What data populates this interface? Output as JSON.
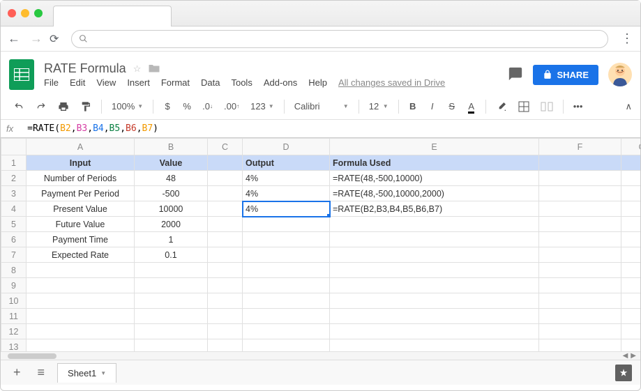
{
  "browser": {},
  "sheets": {
    "title": "RATE Formula",
    "menus": [
      "File",
      "Edit",
      "View",
      "Insert",
      "Format",
      "Data",
      "Tools",
      "Add-ons",
      "Help"
    ],
    "changes_saved": "All changes saved in Drive",
    "share_label": "SHARE"
  },
  "toolbar": {
    "zoom": "100%",
    "font": "Calibri",
    "font_size": "12"
  },
  "formula_bar": {
    "fx": "fx",
    "parts": [
      {
        "t": "=RATE(",
        "c": "#000"
      },
      {
        "t": "B2",
        "c": "#f29900"
      },
      {
        "t": ",",
        "c": "#000"
      },
      {
        "t": "B3",
        "c": "#d53ea4"
      },
      {
        "t": ",",
        "c": "#000"
      },
      {
        "t": "B4",
        "c": "#1a73e8"
      },
      {
        "t": ",",
        "c": "#000"
      },
      {
        "t": "B5",
        "c": "#0b8043"
      },
      {
        "t": ",",
        "c": "#000"
      },
      {
        "t": "B6",
        "c": "#c53929"
      },
      {
        "t": ",",
        "c": "#000"
      },
      {
        "t": "B7",
        "c": "#f29900"
      },
      {
        "t": ")",
        "c": "#000"
      }
    ]
  },
  "grid": {
    "columns": [
      "A",
      "B",
      "C",
      "D",
      "E",
      "F",
      "G"
    ],
    "header": {
      "A": "Input",
      "B": "Value",
      "D": "Output",
      "E": "Formula Used"
    },
    "rows": [
      {
        "n": 2,
        "A": "Number of Periods",
        "B": "48",
        "D": "4%",
        "E": "=RATE(48,-500,10000)"
      },
      {
        "n": 3,
        "A": "Payment Per Period",
        "B": "-500",
        "D": "4%",
        "E": "=RATE(48,-500,10000,2000)"
      },
      {
        "n": 4,
        "A": "Present Value",
        "B": "10000",
        "D": "4%",
        "E": "=RATE(B2,B3,B4,B5,B6,B7)"
      },
      {
        "n": 5,
        "A": "Future Value",
        "B": "2000",
        "D": "",
        "E": ""
      },
      {
        "n": 6,
        "A": "Payment Time",
        "B": "1",
        "D": "",
        "E": ""
      },
      {
        "n": 7,
        "A": "Expected Rate",
        "B": "0.1",
        "D": "",
        "E": ""
      },
      {
        "n": 8
      },
      {
        "n": 9
      },
      {
        "n": 10
      },
      {
        "n": 11
      },
      {
        "n": 12
      },
      {
        "n": 13
      }
    ],
    "selected": "D4"
  },
  "tabs": {
    "sheet1": "Sheet1"
  }
}
